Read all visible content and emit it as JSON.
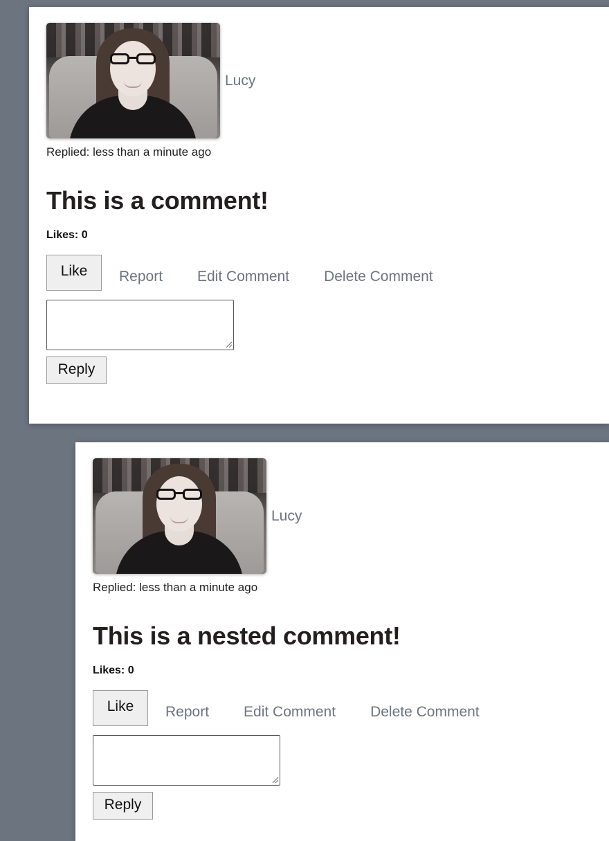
{
  "comments": [
    {
      "author": "Lucy",
      "replied": "Replied: less than a minute ago",
      "text": "This is a comment!",
      "likes": "Likes: 0",
      "actions": {
        "like": "Like",
        "report": "Report",
        "edit": "Edit Comment",
        "delete": "Delete Comment"
      },
      "reply_value": "",
      "reply_button": "Reply"
    },
    {
      "author": "Lucy",
      "replied": "Replied: less than a minute ago",
      "text": "This is a nested comment!",
      "likes": "Likes: 0",
      "actions": {
        "like": "Like",
        "report": "Report",
        "edit": "Edit Comment",
        "delete": "Delete Comment"
      },
      "reply_value": "",
      "reply_button": "Reply"
    }
  ],
  "colors": {
    "page_background": "#6b747f",
    "card_background": "#ffffff",
    "link_gray": "#6c7480",
    "heading": "#231f1f"
  }
}
